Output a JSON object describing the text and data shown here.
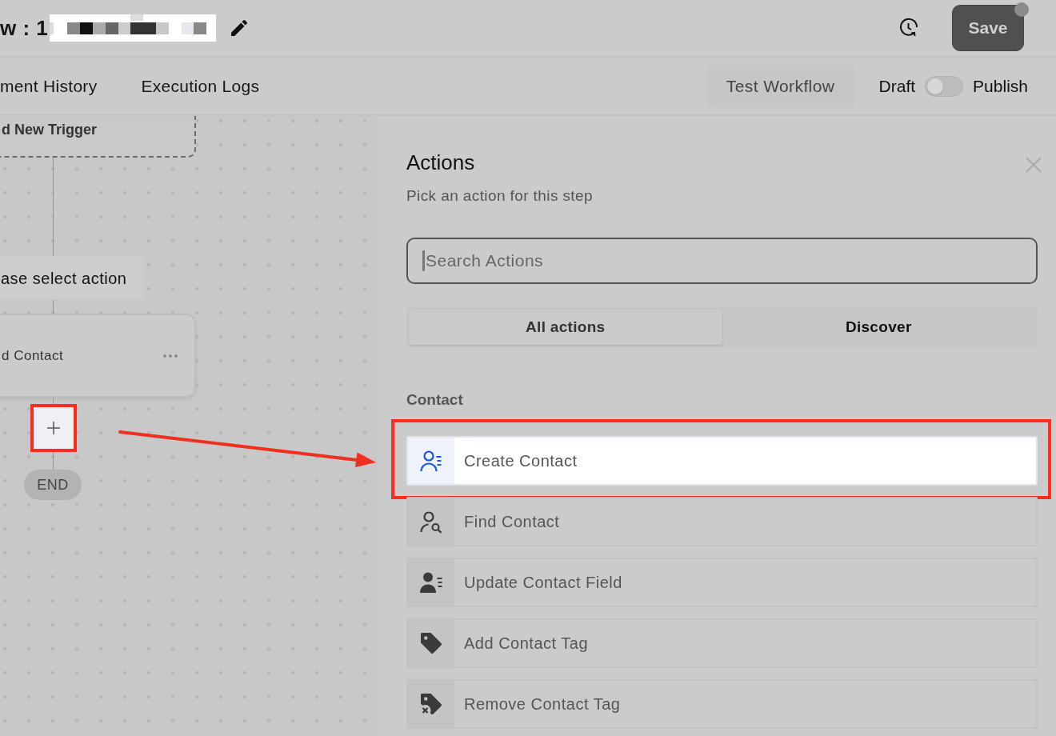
{
  "header": {
    "title": "w : 1",
    "save_button": "Save"
  },
  "nav_tabs": [
    {
      "label": "ment History",
      "selected": false
    },
    {
      "label": "Execution Logs",
      "selected": false
    }
  ],
  "test_button": "Test Workflow",
  "publish_switch": {
    "off_label": "Draft",
    "on_label": "Publish",
    "on": false
  },
  "canvas": {
    "nodes": [
      {
        "kind": "trigger",
        "label": "d New Trigger"
      },
      {
        "kind": "placeholder",
        "label": "ase select action"
      },
      {
        "kind": "action",
        "label": "d Contact"
      },
      {
        "kind": "add",
        "annotated": true
      },
      {
        "kind": "end",
        "label": "END"
      }
    ]
  },
  "panel": {
    "title": "Actions",
    "subtitle": "Pick an action for this step",
    "search": {
      "placeholder": "Search Actions"
    },
    "tabs": [
      {
        "label": "All actions",
        "selected": true
      },
      {
        "label": "Discover",
        "selected": false
      }
    ],
    "section": "Contact",
    "items": [
      {
        "kind": "create",
        "label": "Create Contact",
        "selected": true,
        "annotated": true
      },
      {
        "kind": "find",
        "label": "Find Contact",
        "selected": false,
        "annotated": false
      },
      {
        "kind": "update",
        "label": "Update Contact Field",
        "selected": false,
        "annotated": false
      },
      {
        "kind": "add_tag",
        "label": "Add Contact Tag",
        "selected": false,
        "annotated": false
      },
      {
        "kind": "remove_tag",
        "label": "Remove Contact Tag",
        "selected": false,
        "annotated": false
      }
    ]
  }
}
